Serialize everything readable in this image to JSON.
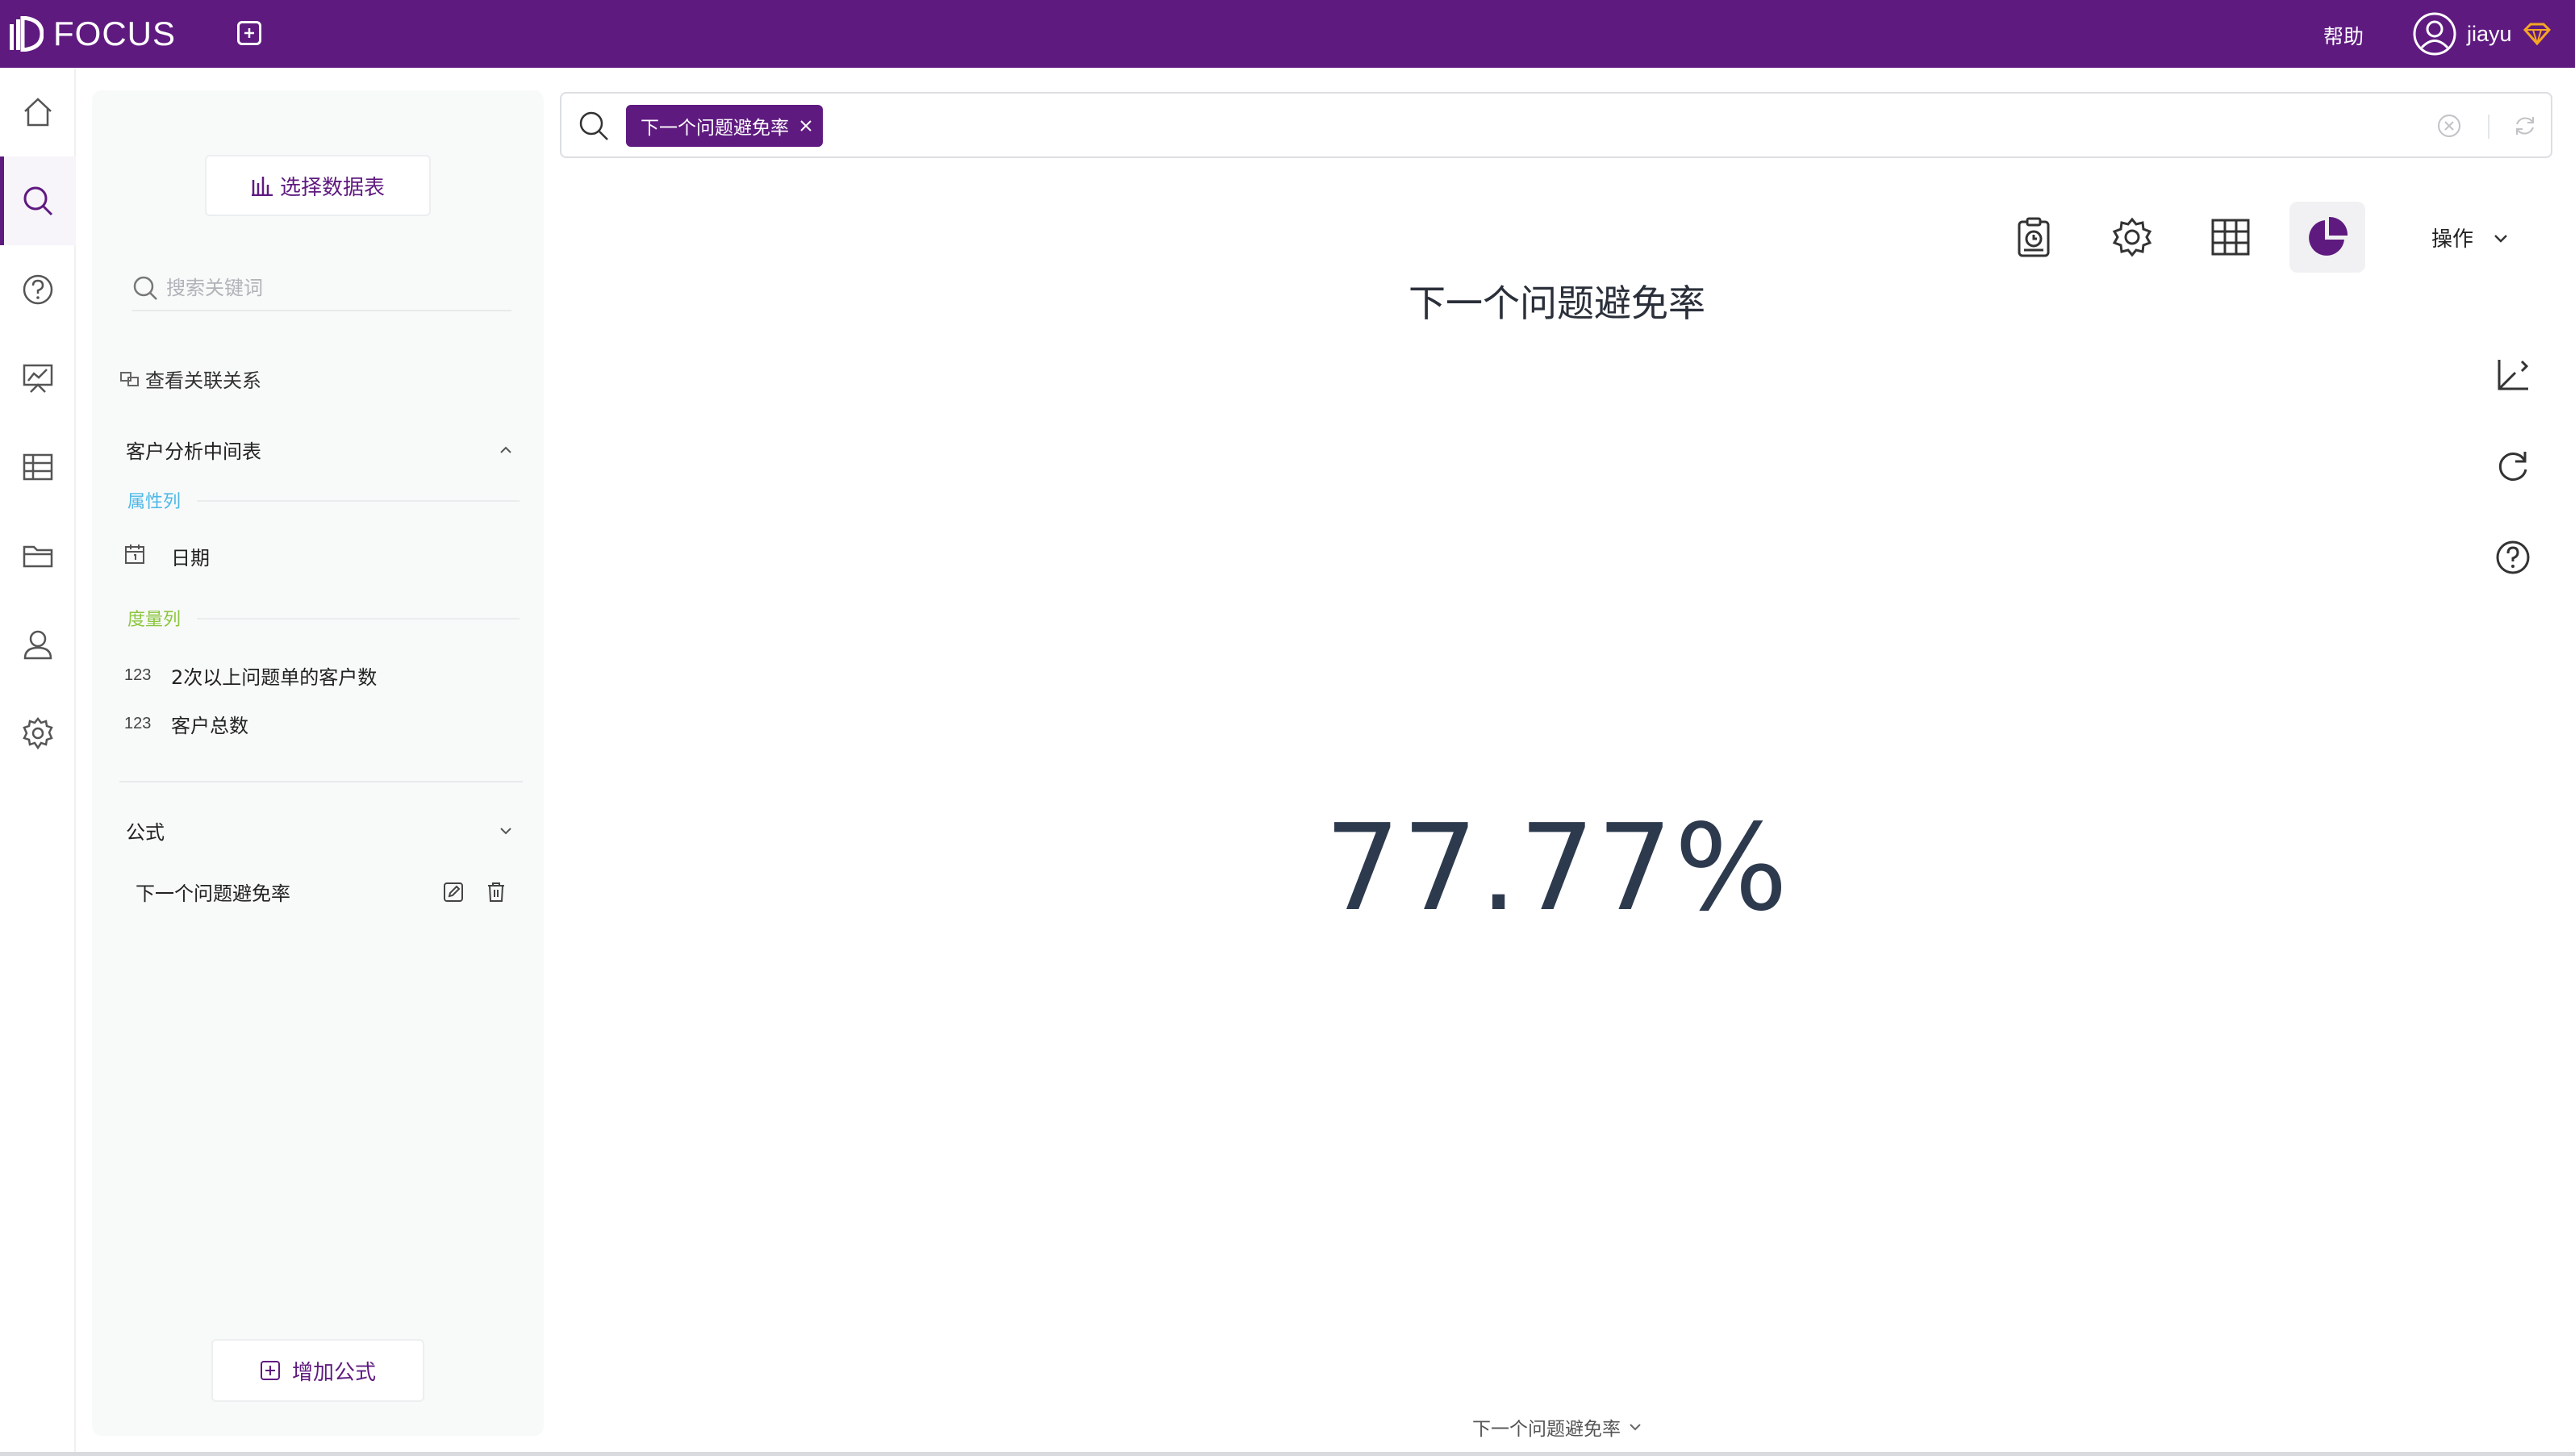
{
  "app": {
    "logo_text": "FOCUS",
    "brand_color": "#5f1a80"
  },
  "header": {
    "help_label": "帮助",
    "user_name": "jiayu"
  },
  "rail": {
    "items": [
      {
        "icon": "home-icon"
      },
      {
        "icon": "search-icon",
        "active": true
      },
      {
        "icon": "question-icon"
      },
      {
        "icon": "dashboard-icon"
      },
      {
        "icon": "table-icon"
      },
      {
        "icon": "folder-icon"
      },
      {
        "icon": "user-icon"
      },
      {
        "icon": "gear-icon"
      }
    ]
  },
  "panel": {
    "select_table_label": "选择数据表",
    "search_placeholder": "搜索关键词",
    "relation_label": "查看关联关系",
    "table_name": "客户分析中间表",
    "attribute_section": "属性列",
    "attribute_color": "#4db8e8",
    "attributes": [
      {
        "type_icon": "calendar-icon",
        "name": "日期"
      }
    ],
    "measure_section": "度量列",
    "measure_color": "#8cc63f",
    "measures": [
      {
        "type": "123",
        "name": "2次以上问题单的客户数"
      },
      {
        "type": "123",
        "name": "客户总数"
      }
    ],
    "formula_section": "公式",
    "formulas": [
      {
        "name": "下一个问题避免率"
      }
    ],
    "add_formula_label": "增加公式"
  },
  "search": {
    "chips": [
      {
        "label": "下一个问题避免率"
      }
    ]
  },
  "toolbar": {
    "ops_label": "操作"
  },
  "result": {
    "title": "下一个问题避免率",
    "kpi_value": "77.77%",
    "measure_selector": "下一个问题避免率"
  }
}
